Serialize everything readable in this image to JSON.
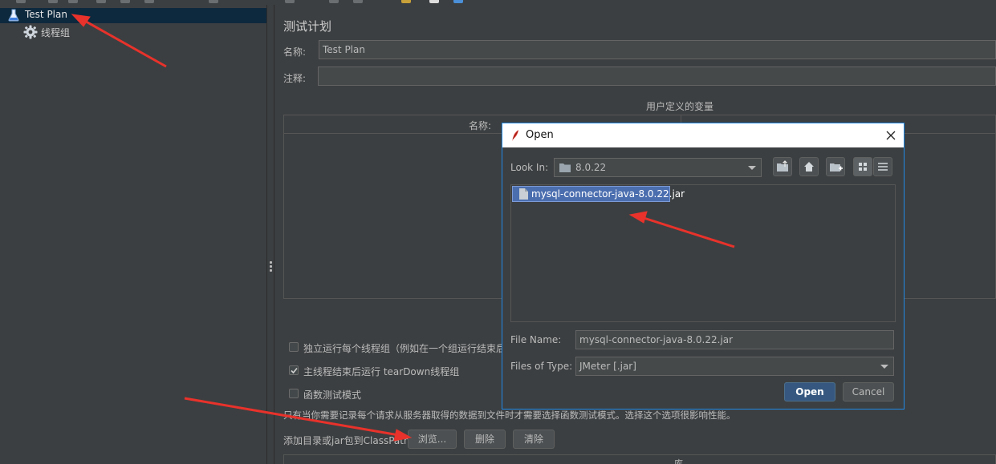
{
  "tree": {
    "items": [
      {
        "label": "Test Plan",
        "icon": "flask-icon",
        "selected": true
      },
      {
        "label": "线程组",
        "icon": "gear-icon",
        "selected": false
      }
    ]
  },
  "panel": {
    "title": "测试计划",
    "name_label": "名称:",
    "name_value": "Test Plan",
    "comment_label": "注释:",
    "comment_value": "",
    "vars_title": "用户定义的变量",
    "vars_col_name": "名称:",
    "options": [
      {
        "label": "独立运行每个线程组（例如在一个组运行结束后",
        "checked": false
      },
      {
        "label": "主线程结束后运行 tearDown线程组",
        "checked": true
      },
      {
        "label": "函数测试模式",
        "checked": false
      }
    ],
    "hint": "只有当你需要记录每个请求从服务器取得的数据到文件时才需要选择函数测试模式。选择这个选项很影响性能。",
    "classpath_label": "添加目录或jar包到ClassPath",
    "browse_button": "浏览...",
    "delete_button": "删除",
    "clear_button": "清除",
    "bottom_header": "库"
  },
  "dialog": {
    "title": "Open",
    "look_in_label": "Look In:",
    "look_in_value": "8.0.22",
    "files": [
      {
        "name": "mysql-connector-java-8.0.22.jar",
        "selected": true
      }
    ],
    "file_name_label": "File Name:",
    "file_name_value": "mysql-connector-java-8.0.22.jar",
    "file_type_label": "Files of Type:",
    "file_type_value": "JMeter [.jar]",
    "open_button": "Open",
    "cancel_button": "Cancel"
  },
  "colors": {
    "background": "#3c3f41",
    "selection": "#0d293e",
    "file_selection": "#4b6eaf",
    "open_button": "#365880",
    "annotation": "#e8322b",
    "dialog_border": "#1e88e5"
  }
}
